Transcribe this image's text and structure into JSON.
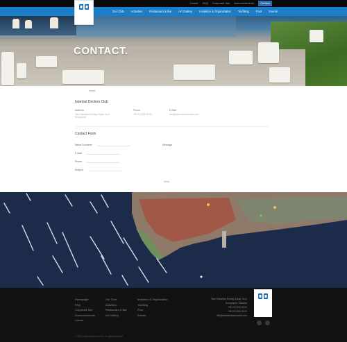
{
  "top_links": [
    "Career",
    "FAQ",
    "Corporate Info",
    "Announcements",
    "Contact"
  ],
  "nav": [
    "Our Club",
    "Activities",
    "Restaurant & Bar",
    "Art Gallery",
    "Invitation & Organization",
    "Yachting",
    "Pool",
    "Events"
  ],
  "hero": {
    "title": "CONTACT."
  },
  "content": {
    "breadcrumb": "Home",
    "info_title": "Istanbul Doctors Club",
    "info": [
      {
        "label": "Address",
        "value": "Tahir Mahallesi Kuntay Sokak, No:2 Kuruçeşme"
      },
      {
        "label": "Phone",
        "value": "+90 212 000 00 00"
      },
      {
        "label": "E-Mail",
        "value": "info@istanbuldoctorsclub.com"
      }
    ],
    "form_title": "Contact Form",
    "form_fields": [
      "Name Surname",
      "E-Mail",
      "Phone",
      "Subject"
    ],
    "message_label": "Message",
    "submit_label": "Send"
  },
  "footer": {
    "col1": [
      "Homepage",
      "FAQ",
      "Corporate Info",
      "Announcements",
      "Career"
    ],
    "col2": [
      "Our Club",
      "Activities",
      "Restaurant & Bar",
      "Art Gallery"
    ],
    "col3": [
      "Invitation & Organization",
      "Yachting",
      "Pool",
      "Events"
    ],
    "address_lines": [
      "Tahir Mahallesi Kuntay Sokak, No:2",
      "Kuruçeşme / İstanbul",
      "+90 212 000 00 00",
      "+90 212 000 00 01",
      "info@istanbuldoctorsclub.com"
    ],
    "copyright": "© 2016 Istanbul Doctors Club. All rights reserved."
  },
  "colors": {
    "nav": "#1a7ec8",
    "topbar": "#0a0a0a",
    "footer": "#121212",
    "map_water": "#1d2b4a"
  }
}
